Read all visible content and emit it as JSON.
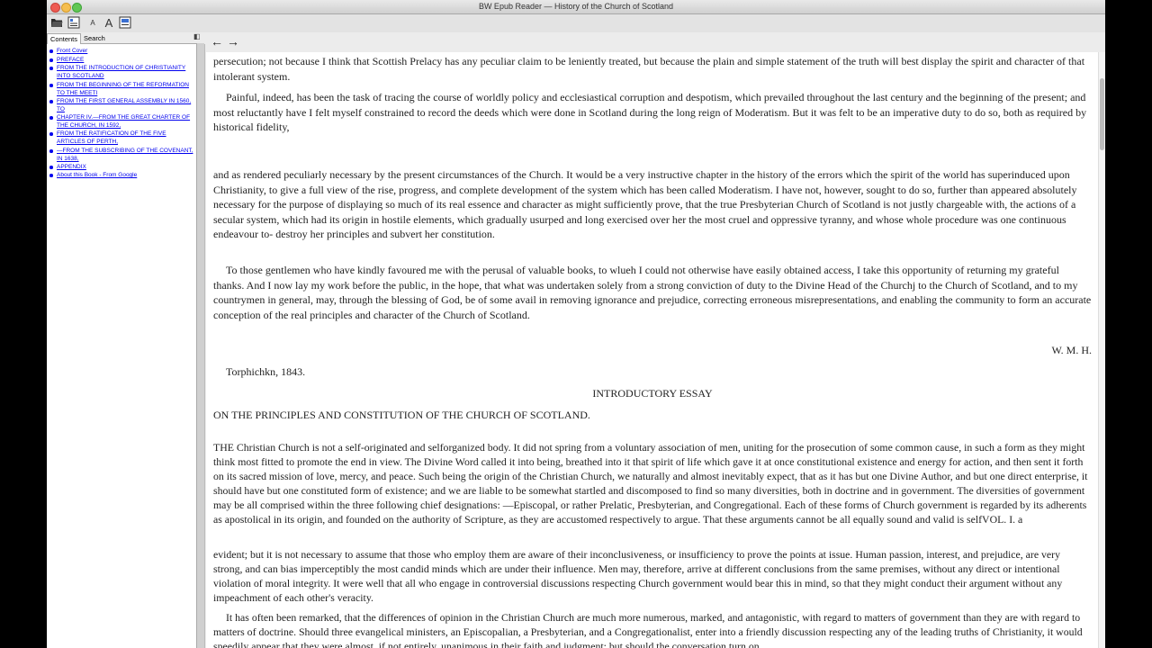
{
  "window": {
    "title": "BW Epub Reader — History of the Church of Scotland"
  },
  "sidebar": {
    "tabs": [
      "Contents",
      "Search"
    ],
    "toc": [
      {
        "label": "Front Cover"
      },
      {
        "label": "PREFACE"
      },
      {
        "label": "FROM THE INTRODUCTION OF CHRISTIANITY INTO SCOTLAND"
      },
      {
        "label": "FROM THE BEGINNING OF THE REFORMATION TO THE MEETI"
      },
      {
        "label": "FROM THE FIRST GENERAL ASSEMBLY IN 1560, TO"
      },
      {
        "label": "CHAPTER IV.—FROM THE GREAT CHARTER OF THE CHURCH, IN 1592,"
      },
      {
        "label": "FROM THE RATIFICATION OF THE FIVE ARTICLES OF PERTH,"
      },
      {
        "label": "—FROM THE SUBSCRIBING OF THE COVENANT, IN 1638,"
      },
      {
        "label": "APPENDIX"
      },
      {
        "label": "About this Book - From Google"
      }
    ]
  },
  "document": {
    "p1": "persecution; not because I think that Scottish Prelacy has any peculiar claim to be leniently treated, but because the plain and simple statement of the truth will best display the spirit and character of that intolerant system.",
    "p2": "Painful, indeed, has been the task of tracing the course of worldly policy and ecclesiastical corruption and despotism, which prevailed throughout the last century and the beginning of the present; and most reluctantly have I felt myself constrained to record the deeds which were done in Scotland during the long reign of Moderatism. But it was felt to be an imperative duty to do so, both as required by historical fidelity,",
    "p3": "and as rendered peculiarly necessary by the present circumstances of the Church. It would be a very instructive chapter in the history of the errors which the spirit of the world has superinduced upon Christianity, to give a full view of the rise, progress, and complete development of the system which has been called Moderatism. I have not, however, sought to do so, further than appeared absolutely necessary for the purpose of displaying so much of its real essence and character as might sufficiently prove, that the true Presbyterian Church of Scotland is not justly chargeable with, the actions of a secular system, which had its origin in hostile elements, which gradually usurped and long exercised over her the most cruel and oppressive tyranny, and whose whole procedure was one continuous endeavour to- destroy her principles and subvert her constitution.",
    "p4": "To those gentlemen who have kindly favoured me with the perusal of valuable books, to wlueh I could not otherwise have easily obtained access, I take this opportunity of returning my grateful thanks. And I now lay my work before the public, in the hope, that what was undertaken solely from a strong conviction of duty to the Divine Head of the Churchj to the Church of Scotland, and to my countrymen in general, may, through the blessing of God, be of some avail in removing ignorance and prejudice, correcting erroneous misrepresentations, and enabling the community to form an accurate conception of the real principles and character of the Church of Scotland.",
    "signature": "W. M. H.",
    "place_date": "Torphichkn, 1843.",
    "essay_title": "INTRODUCTORY ESSAY",
    "essay_subtitle": "ON THE PRINCIPLES AND CONSTITUTION OF THE CHURCH OF SCOTLAND.",
    "p5": "THE Christian Church is not a self-originated and selforganized body. It did not spring from a voluntary association of men, uniting for the prosecution of some common cause, in such a form as they might think most fitted to promote the end in view. The Divine Word called it into being, breathed into it that spirit of life which gave it at once constitutional existence and energy for action, and then sent it forth on its sacred mission of love, mercy, and peace. Such being the origin of the Christian Church, we naturally and almost inevitably expect, that as it has but one Divine Author, and but one direct enterprise, it should have but one constituted form of existence; and we are liable to be somewhat startled and discomposed to find so many diversities, both in doctrine and in government. The diversities of government may be all comprised within the three following chief designations: —Episcopal, or rather Prelatic, Presbyterian, and Congregational. Each of these forms of Church government is regarded by its adherents as apostolical in its origin, and founded on the authority of Scripture, as they are accustomed respectively to argue. That these arguments cannot be all equally sound and valid is selfVOL. I. a",
    "p6": "evident; but it is not necessary to assume that those who employ them are aware of their inconclusiveness, or insufficiency to prove the points at issue. Human passion, interest, and prejudice, are very strong, and can bias imperceptibly the most candid minds which are under their influence. Men may, therefore, arrive at different conclusions from the same premises, without any direct or intentional violation of moral integrity. It were well that all who engage in controversial discussions respecting Church government would bear this in mind, so that they might conduct their argument without any impeachment of each other's veracity.",
    "p7": "It has often been remarked, that the differences of opinion in the Christian Church are much more numerous, marked, and antagonistic, with regard to matters of government than they are with regard to matters of doctrine. Should three evangelical ministers, an Episcopalian, a Presbyterian, and a Congregationalist, enter into a friendly discussion respecting any of the leading truths of Christianity, it would speedily appear that they were almost, if not entirely, unanimous in their faith and judgment; but should the conversation turn on"
  },
  "scrollbar": {
    "position": 0.05
  }
}
